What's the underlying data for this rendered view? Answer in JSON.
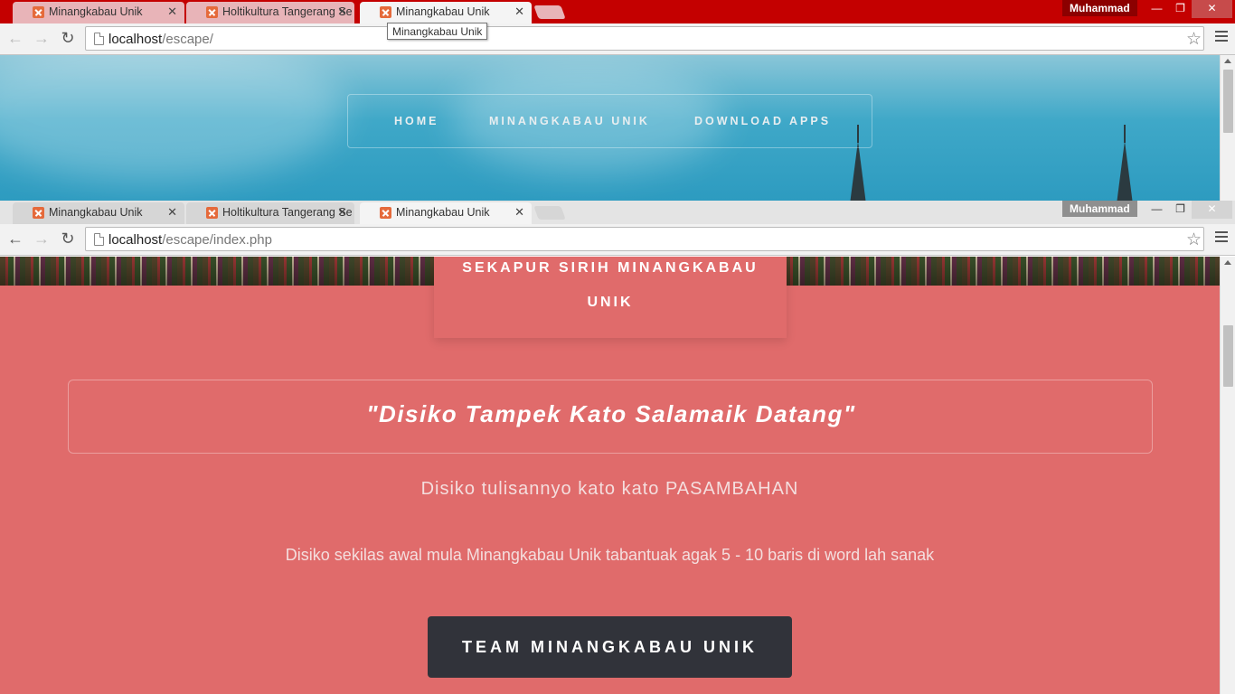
{
  "top_window": {
    "tabs": [
      {
        "title": "Minangkabau Unik",
        "active": false
      },
      {
        "title": "Holtikultura Tangerang Se",
        "active": false
      },
      {
        "title": "Minangkabau Unik",
        "active": true
      }
    ],
    "profile_name": "Muhammad",
    "url_host": "localhost",
    "url_path": "/escape/",
    "tooltip": "Minangkabau Unik",
    "nav": {
      "home": "HOME",
      "minangkabau": "MINANGKABAU UNIK",
      "download": "DOWNLOAD APPS"
    }
  },
  "bottom_window": {
    "tabs": [
      {
        "title": "Minangkabau Unik",
        "active": false
      },
      {
        "title": "Holtikultura Tangerang Se",
        "active": false
      },
      {
        "title": "Minangkabau Unik",
        "active": true
      }
    ],
    "profile_name": "Muhammad",
    "url_host": "localhost",
    "url_path": "/escape/index.php",
    "section_title_line1": "SEKAPUR SIRIH MINANGKABAU",
    "section_title_line2": "UNIK",
    "quote": "\"Disiko Tampek Kato Salamaik Datang\"",
    "subtitle": "Disiko tulisannyo kato kato PASAMBAHAN",
    "description": "Disiko sekilas awal mula Minangkabau Unik tabantuak agak 5 - 10 baris di word lah sanak",
    "team_button": "TEAM MINANGKABAU UNIK"
  },
  "window_controls": {
    "minimize": "—",
    "restore": "❐",
    "close": "✕"
  },
  "colors": {
    "top_tabstrip": "#c40000",
    "page_background": "#e06b6b",
    "team_button": "#31333a"
  }
}
